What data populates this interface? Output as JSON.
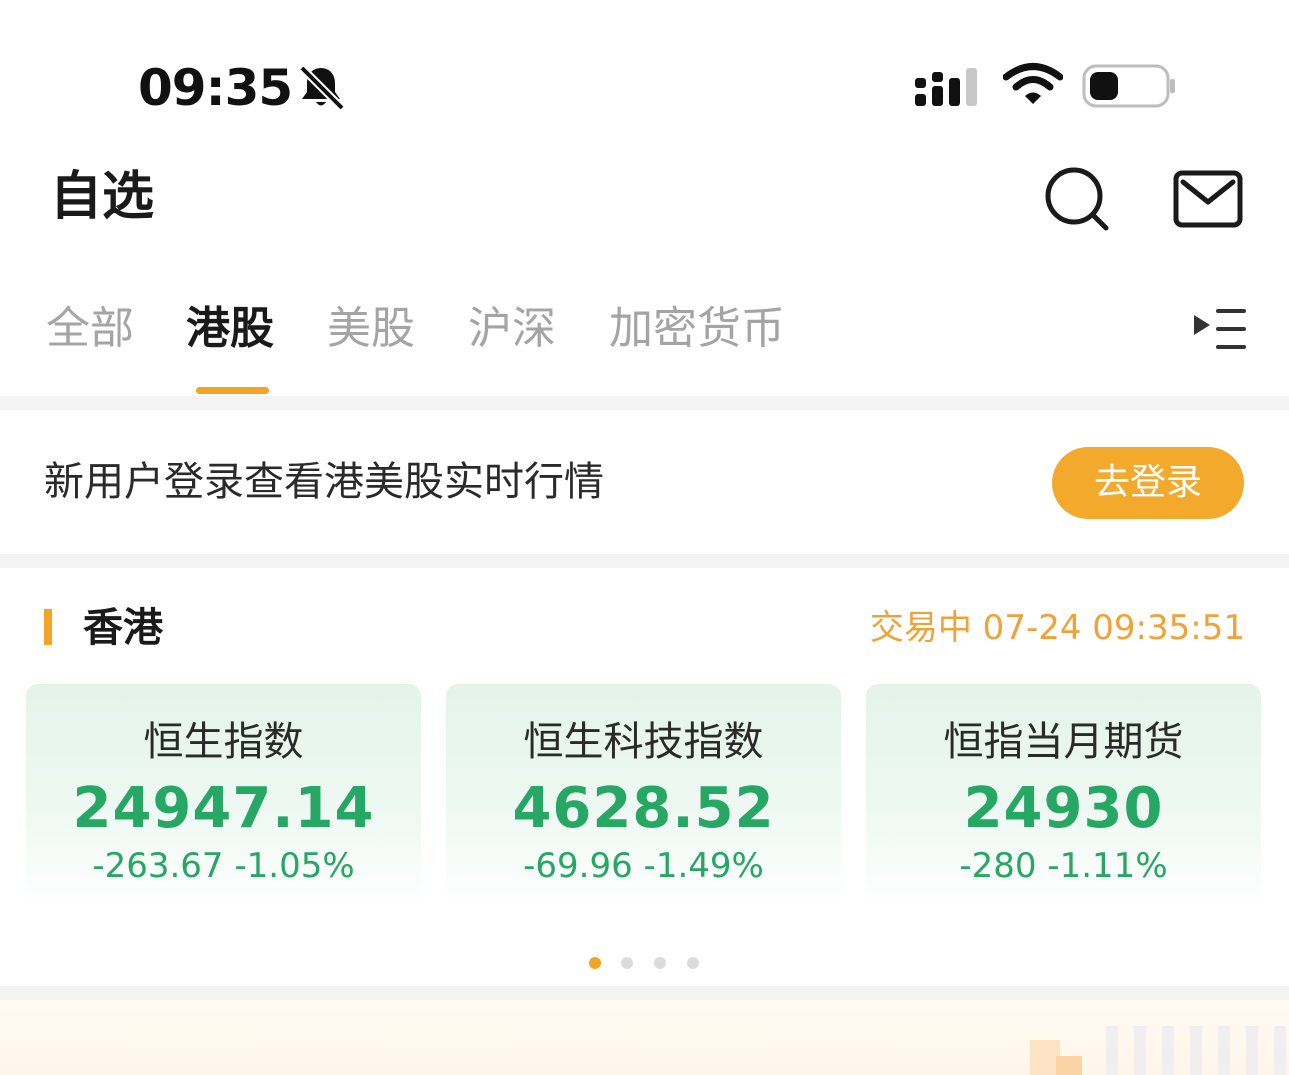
{
  "status_bar": {
    "time": "09:35",
    "icons": [
      "bell-muted-icon",
      "cellular-signal-icon",
      "wifi-icon",
      "battery-icon"
    ]
  },
  "header": {
    "title": "自选",
    "icons": [
      "search-icon",
      "mail-icon"
    ]
  },
  "tabs": [
    {
      "label": "全部",
      "active": false
    },
    {
      "label": "港股",
      "active": true
    },
    {
      "label": "美股",
      "active": false
    },
    {
      "label": "沪深",
      "active": false
    },
    {
      "label": "加密货币",
      "active": false
    }
  ],
  "login_banner": {
    "text": "新用户登录查看港美股实时行情",
    "button_label": "去登录"
  },
  "region": {
    "title": "香港",
    "status": "交易中 07-24 09:35:51"
  },
  "indices": [
    {
      "name": "恒生指数",
      "value": "24947.14",
      "change": "-263.67 -1.05%"
    },
    {
      "name": "恒生科技指数",
      "value": "4628.52",
      "change": "-69.96 -1.49%"
    },
    {
      "name": "恒指当月期货",
      "value": "24930",
      "change": "-280 -1.11%"
    }
  ],
  "pagination": {
    "pages": 4,
    "current": 1
  },
  "colors": {
    "accent": "#f2a426",
    "down_green": "#27a764",
    "card_bg": "#e3f4eb",
    "tab_inactive": "#a4a4a4"
  }
}
